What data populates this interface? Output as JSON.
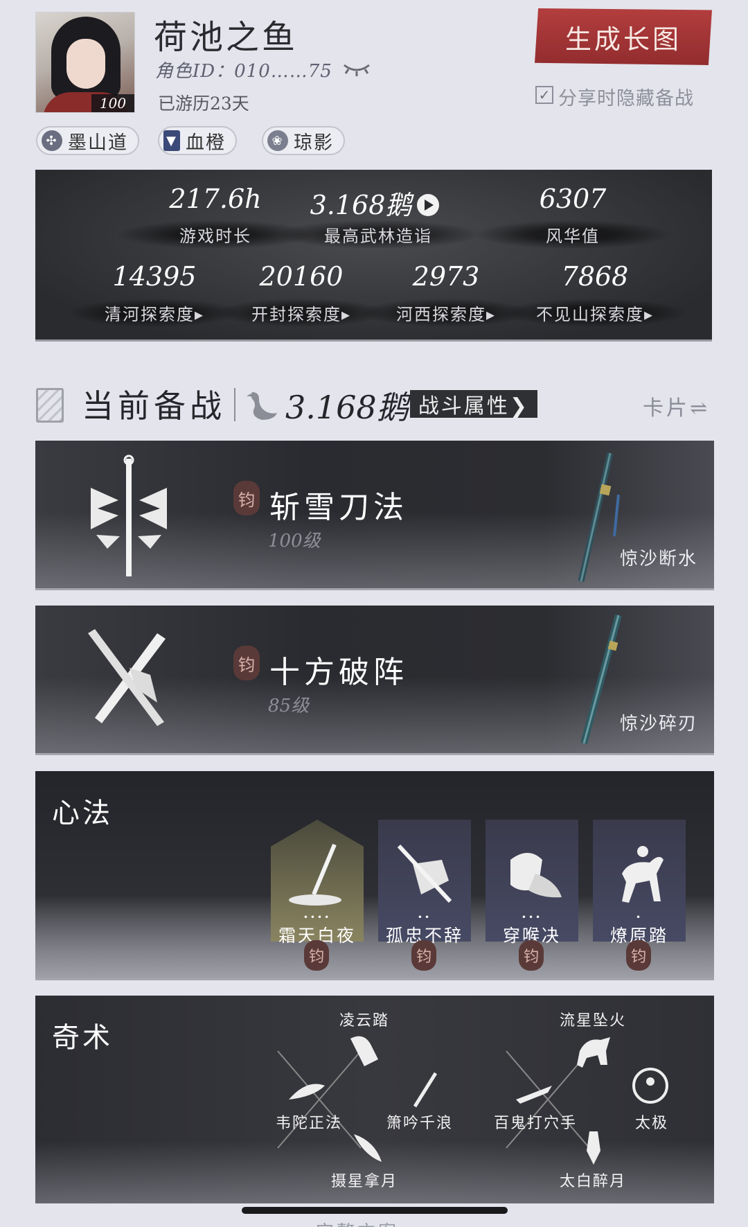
{
  "profile": {
    "name": "荷池之鱼",
    "role_id": "角色ID：010……75",
    "days": "已游历23天",
    "level": "100",
    "generate_button": "生成长图",
    "hide_checkbox_label": "分享时隐藏备战",
    "hide_checked": true,
    "tags": [
      {
        "label": "墨山道",
        "icon": "cross-emblem-icon"
      },
      {
        "label": "血橙",
        "icon": "banner-icon"
      },
      {
        "label": "琼影",
        "icon": "lotus-icon"
      }
    ]
  },
  "stats": {
    "row1": [
      {
        "value": "217.6h",
        "label": "游戏时长"
      },
      {
        "value": "3.168鹅",
        "label": "最高武林造诣"
      },
      {
        "value": "6307",
        "label": "风华值"
      }
    ],
    "row2": [
      {
        "value": "14395",
        "label": "清河探索度▸"
      },
      {
        "value": "20160",
        "label": "开封探索度▸"
      },
      {
        "value": "2973",
        "label": "河西探索度▸"
      },
      {
        "value": "7868",
        "label": "不见山探索度▸"
      }
    ]
  },
  "prep": {
    "title": "当前备战",
    "power": "3.168鹅",
    "attr_button": "战斗属性❯",
    "view_toggle": "卡片⇌"
  },
  "weapons": [
    {
      "name": "斩雪刀法",
      "level": "100级",
      "seal": "钧",
      "blade": "惊沙断水"
    },
    {
      "name": "十方破阵",
      "level": "85级",
      "seal": "钧",
      "blade": "惊沙碎刃"
    }
  ],
  "xinfa": {
    "title": "心法",
    "items": [
      {
        "label": "霜天白夜",
        "dots": "••••",
        "seal": "钧"
      },
      {
        "label": "孤忠不辞",
        "dots": "••",
        "seal": "钧"
      },
      {
        "label": "穿喉决",
        "dots": "•••",
        "seal": "钧"
      },
      {
        "label": "燎原踏",
        "dots": "•",
        "seal": "钧"
      }
    ]
  },
  "qishu": {
    "title": "奇术",
    "left": {
      "top": "凌云踏",
      "left": "韦陀正法",
      "right": "箫吟千浪",
      "bottom": "摄星拿月"
    },
    "right": {
      "top": "流星坠火",
      "left": "百鬼打穴手",
      "right": "太极",
      "bottom": "太白醉月"
    }
  },
  "footer_peek": "完整方案",
  "colors": {
    "accent_red": "#a13535",
    "panel_dark": "#2a2b2e"
  }
}
